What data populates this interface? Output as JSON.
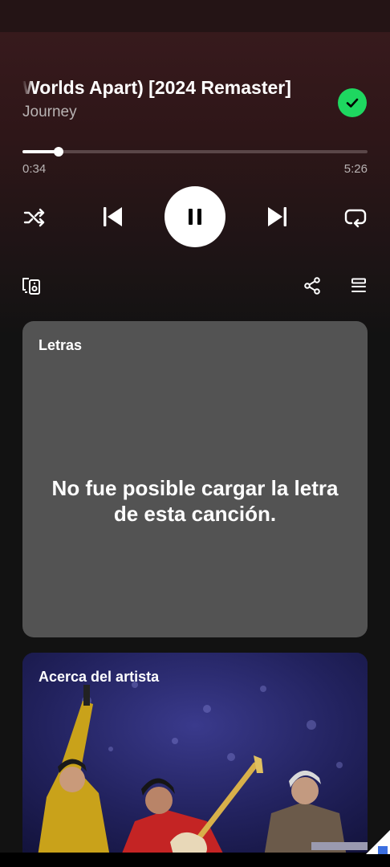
{
  "now_playing": {
    "title": "Worlds Apart) [2024 Remaster]",
    "artist": "Journey",
    "elapsed": "0:34",
    "duration": "5:26",
    "progress_fraction": 0.105,
    "liked": true
  },
  "controls": {
    "shuffle_icon": "shuffle-icon",
    "previous_icon": "skip-previous-icon",
    "play_pause_icon": "pause-icon",
    "next_icon": "skip-next-icon",
    "repeat_icon": "repeat-icon",
    "devices_icon": "connect-devices-icon",
    "share_icon": "share-icon",
    "queue_icon": "queue-icon"
  },
  "lyrics": {
    "heading": "Letras",
    "message": "No fue posible cargar la letra de esta canción."
  },
  "about_artist": {
    "heading": "Acerca del artista"
  },
  "colors": {
    "accent_green": "#1ed760",
    "lyrics_card": "#535353",
    "background": "#121212"
  }
}
